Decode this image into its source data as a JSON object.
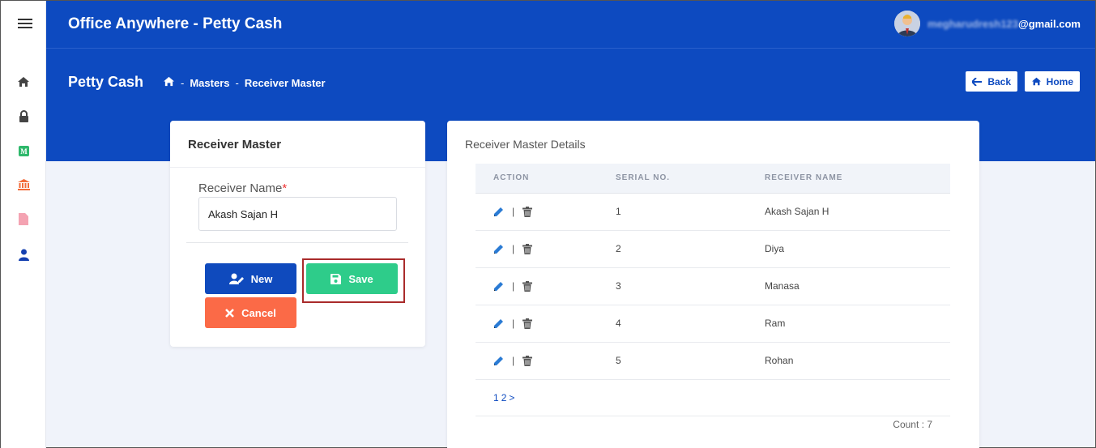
{
  "app": {
    "title": "Office Anywhere - Petty Cash"
  },
  "user": {
    "email_hidden": "megharudresh123",
    "email_domain": "@gmail.com"
  },
  "sidebar": {
    "icons": [
      "home-icon",
      "lock-icon",
      "masters-icon",
      "bank-icon",
      "document-icon",
      "user-icon"
    ]
  },
  "header": {
    "page_title": "Petty Cash",
    "breadcrumb": {
      "masters": "Masters",
      "current": "Receiver Master",
      "separator": "-"
    },
    "back_label": "Back",
    "home_label": "Home"
  },
  "form": {
    "title": "Receiver Master",
    "field_label": "Receiver Name",
    "required_mark": "*",
    "field_value": "Akash Sajan H",
    "new_label": "New",
    "save_label": "Save",
    "cancel_label": "Cancel"
  },
  "details": {
    "title": "Receiver Master Details",
    "columns": [
      "ACTION",
      "SERIAL NO.",
      "RECEIVER NAME"
    ],
    "rows": [
      {
        "serial": "1",
        "name": "Akash Sajan H"
      },
      {
        "serial": "2",
        "name": "Diya"
      },
      {
        "serial": "3",
        "name": "Manasa"
      },
      {
        "serial": "4",
        "name": "Ram"
      },
      {
        "serial": "5",
        "name": "Rohan"
      }
    ],
    "pagination": [
      "1",
      "2",
      ">"
    ],
    "count_label": "Count : 7"
  },
  "colors": {
    "primary": "#0d4ac0",
    "save": "#2ecc8a",
    "cancel": "#fb6a47",
    "new": "#0f4abd"
  }
}
